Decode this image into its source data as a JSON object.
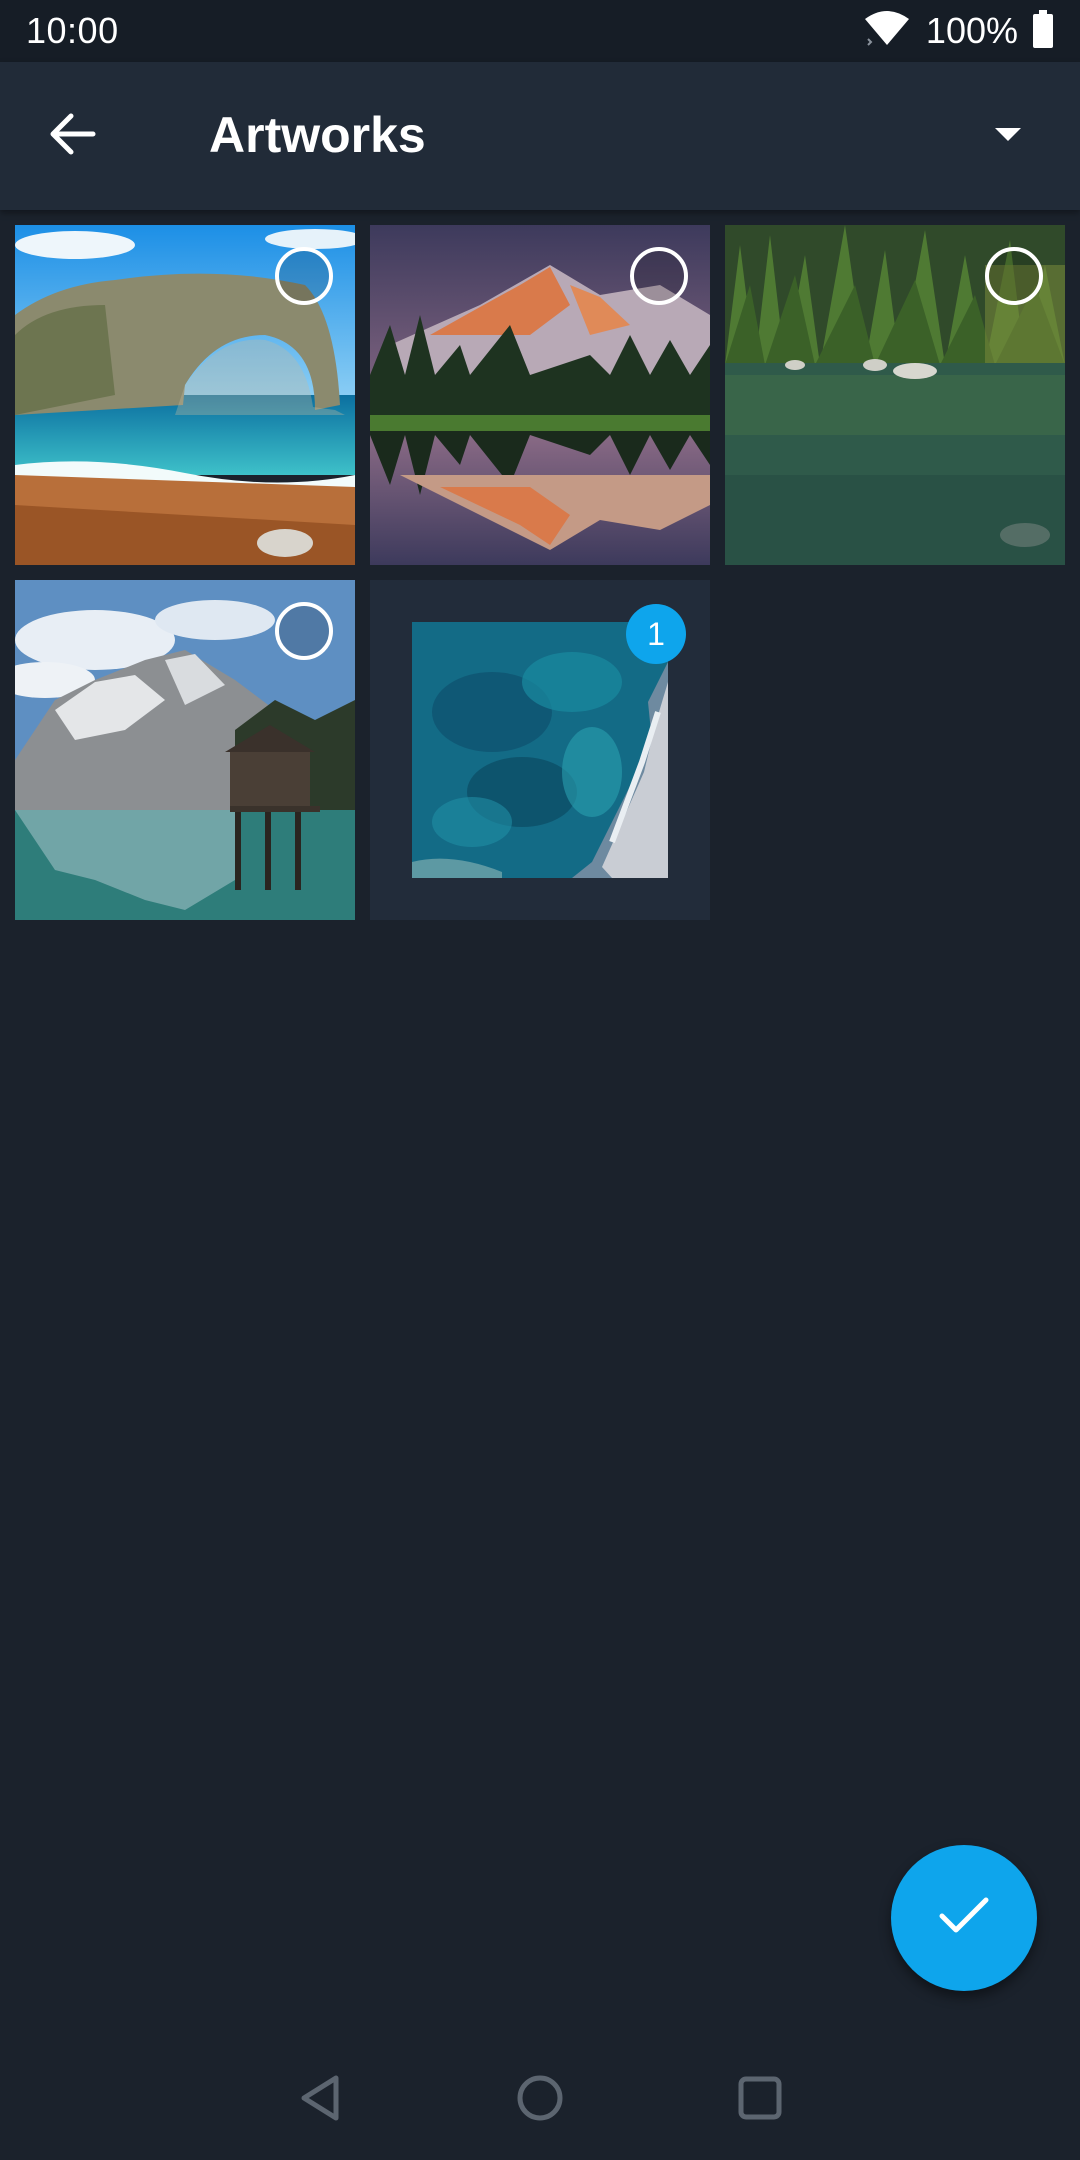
{
  "status_bar": {
    "time": "10:00",
    "battery_text": "100%",
    "icons": [
      "wifi-icon",
      "battery-icon"
    ]
  },
  "app_bar": {
    "title": "Artworks",
    "back_icon": "arrow-back-icon",
    "dropdown_icon": "dropdown-arrow-icon"
  },
  "artworks": [
    {
      "name": "sea-arch-beach",
      "selected": false
    },
    {
      "name": "mountain-lake-reflection-sunset",
      "selected": false
    },
    {
      "name": "green-forest-lake",
      "selected": false
    },
    {
      "name": "alpine-lake-boathouse",
      "selected": false
    },
    {
      "name": "aerial-turquoise-coast",
      "selected": true,
      "selection_number": "1"
    }
  ],
  "fab": {
    "icon": "check-icon"
  },
  "nav_bar": {
    "icons": [
      "back-triangle-icon",
      "home-circle-icon",
      "recents-square-icon"
    ]
  },
  "colors": {
    "background": "#1b222c",
    "app_bar": "#212b38",
    "accent": "#0ea5ec"
  }
}
